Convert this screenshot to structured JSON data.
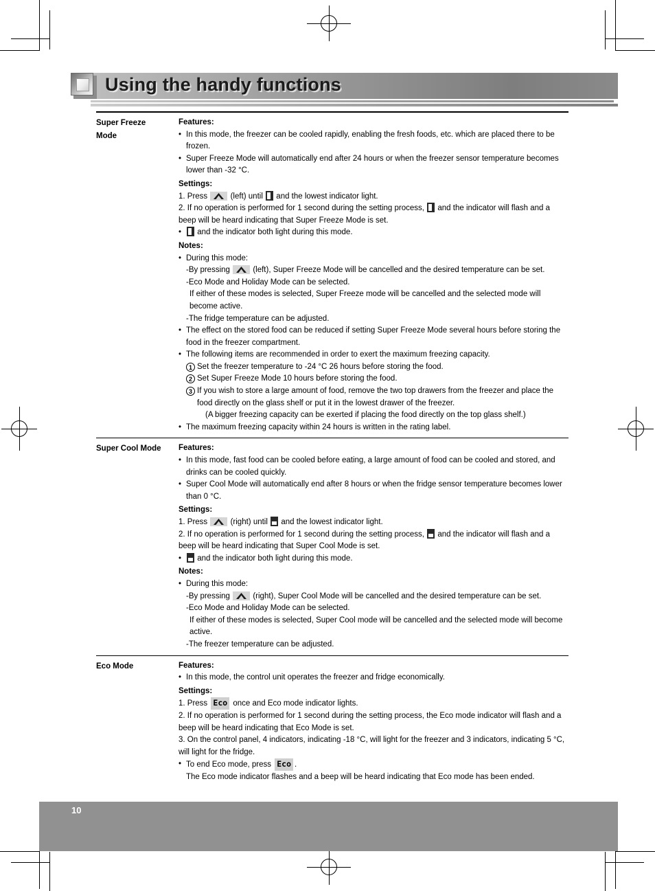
{
  "header": {
    "title": "Using the handy functions",
    "icon": "beveled-square-icon"
  },
  "footer": {
    "page_number": "10"
  },
  "icons": {
    "freeze": "freezer-indicator-icon",
    "cool": "fridge-indicator-icon",
    "caret": "up-arrow-button-icon",
    "eco_label": "Eco"
  },
  "sections": [
    {
      "label_lines": [
        "Super Freeze",
        "Mode"
      ],
      "blocks": {
        "features_heading": "Features:",
        "features": [
          "In this mode, the freezer can be cooled rapidly, enabling the fresh foods, etc. which are placed there to be frozen.",
          "Super Freeze Mode will automatically end after 24 hours or when the freezer sensor temperature becomes lower than -32 °C."
        ],
        "settings_heading": "Settings:",
        "settings": {
          "step1_a": "1. Press",
          "step1_b": "(left) until",
          "step1_c": "and the lowest indicator light.",
          "step2_a": "2. If no operation is performed for 1 second during the setting process,",
          "step2_b": "and the indicator will flash and a beep will be heard indicating that Super Freeze Mode is set.",
          "bullet_a": "and the indicator both light during this mode."
        },
        "notes_heading": "Notes:",
        "notes": {
          "during_mode": "During this mode:",
          "press_a": "-By pressing",
          "press_b": "(left), Super Freeze Mode will be cancelled and the desired temperature can be set.",
          "eco_holiday": "-Eco Mode and Holiday Mode can be selected.",
          "eco_holiday_2": "If either of these modes is selected, Super Freeze mode will be cancelled and the selected mode will become active.",
          "fridge_adjust": "-The fridge temperature can be adjusted."
        },
        "extra_bullets": [
          "The effect on the stored food can be reduced if setting Super Freeze Mode several hours before storing the food in the freezer compartment.",
          "The following items are recommended in order to exert the maximum freezing capacity."
        ],
        "numbered": [
          {
            "n": "1",
            "text": "Set the freezer temperature to -24 °C 26 hours before storing the food."
          },
          {
            "n": "2",
            "text": "Set Super Freeze Mode 10 hours before storing the food."
          },
          {
            "n": "3",
            "text": "If you wish to store a large amount of food, remove the two top drawers from the freezer and place the food directly on the glass shelf or put it in the lowest drawer of the freezer."
          }
        ],
        "numbered_note": "(A bigger freezing capacity can be exerted if placing the food directly on the top glass shelf.)",
        "final_bullet": "The maximum freezing capacity within 24 hours is written in the rating label."
      }
    },
    {
      "label_lines": [
        "Super Cool Mode"
      ],
      "blocks": {
        "features_heading": "Features:",
        "features": [
          "In this mode, fast food can be cooled before eating, a large amount of food can be cooled and stored, and drinks can be cooled quickly.",
          "Super Cool Mode will automatically end after 8 hours or when the fridge sensor temperature becomes lower than 0 °C."
        ],
        "settings_heading": "Settings:",
        "settings": {
          "step1_a": "1. Press",
          "step1_b": "(right) until",
          "step1_c": "and the lowest indicator light.",
          "step2_a": "2. If no operation is performed for 1 second during the setting process,",
          "step2_b": "and the indicator will flash and a beep will be heard indicating that Super Cool Mode is set.",
          "bullet_a": "and the indicator both light during this mode."
        },
        "notes_heading": "Notes:",
        "notes": {
          "during_mode": "During this mode:",
          "press_a": "-By pressing",
          "press_b": "(right), Super Cool Mode will be cancelled and the desired temperature can be set.",
          "eco_holiday": "-Eco Mode and Holiday Mode can be selected.",
          "eco_holiday_2": "If either of these modes is selected, Super Cool mode will be cancelled and the selected mode will become active.",
          "freezer_adjust": "-The freezer temperature can be adjusted."
        }
      }
    },
    {
      "label_lines": [
        "Eco Mode"
      ],
      "blocks": {
        "features_heading": "Features:",
        "features": [
          "In this mode, the control unit operates the freezer and fridge economically."
        ],
        "settings_heading": "Settings:",
        "settings": {
          "step1_a": "1. Press",
          "step1_b": "once and Eco mode indicator lights.",
          "step2": "2. If no operation is performed for 1 second during the setting process, the Eco mode indicator will flash and a beep will be heard indicating that Eco Mode is set.",
          "step3": "3. On the control panel, 4 indicators, indicating -18 °C, will light for the freezer and 3 indicators, indicating 5 °C, will light for the fridge.",
          "end_a": "To end Eco mode, press",
          "end_b": ".",
          "end_note": "The Eco mode indicator flashes and a beep will be heard indicating that Eco mode has been ended."
        }
      }
    }
  ]
}
